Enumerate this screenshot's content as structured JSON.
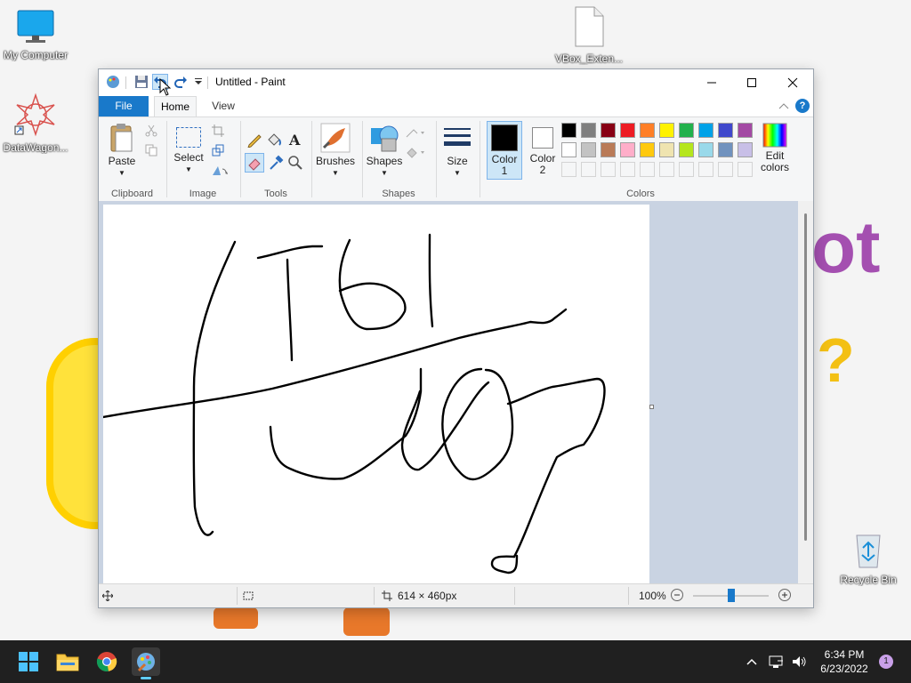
{
  "desktop": {
    "icons": [
      {
        "label": "My Computer"
      },
      {
        "label": "VBox_Exten..."
      },
      {
        "label": "DataWagon..."
      },
      {
        "label": "Recycle Bin"
      }
    ],
    "decor": {
      "ot": "ot",
      "question": "?"
    }
  },
  "window": {
    "title": "Untitled - Paint",
    "tabs": {
      "file": "File",
      "home": "Home",
      "view": "View"
    },
    "ribbon": {
      "clipboard": {
        "paste": "Paste",
        "label": "Clipboard"
      },
      "image": {
        "select": "Select",
        "label": "Image"
      },
      "tools": {
        "label": "Tools"
      },
      "brushes": {
        "label": "Brushes"
      },
      "shapes": {
        "shapes_btn": "Shapes",
        "label": "Shapes"
      },
      "size": {
        "label": "Size"
      },
      "colors": {
        "color1": "Color 1",
        "color2": "Color 2",
        "edit": "Edit colors",
        "label": "Colors",
        "color1_value": "#000000",
        "color2_value": "#ffffff",
        "palette_row1": [
          "#000000",
          "#7f7f7f",
          "#880015",
          "#ed1c24",
          "#ff7f27",
          "#fff200",
          "#22b14c",
          "#00a2e8",
          "#3f48cc",
          "#a349a4"
        ],
        "palette_row2": [
          "#ffffff",
          "#c3c3c3",
          "#b97a57",
          "#ffaec9",
          "#ffc90e",
          "#efe4b0",
          "#b5e61d",
          "#99d9ea",
          "#7092be",
          "#c8bfe7"
        ]
      }
    },
    "status": {
      "canvas_size": "614 × 460px",
      "zoom": "100%",
      "zoom_level": 0.5
    }
  },
  "taskbar": {
    "time": "6:34 PM",
    "date": "6/23/2022",
    "notification_count": "1"
  }
}
